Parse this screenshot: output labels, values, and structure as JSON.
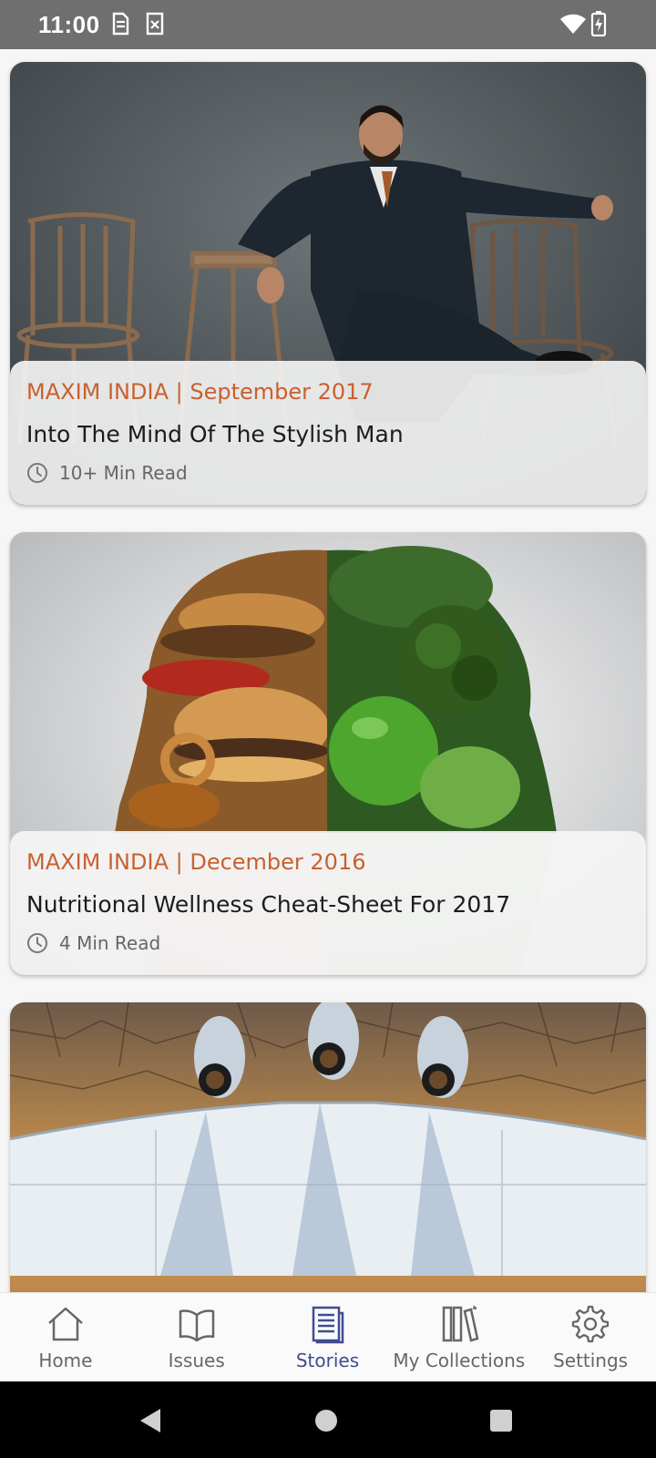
{
  "status_bar": {
    "time": "11:00",
    "icons": [
      "sim-card-icon",
      "storage-icon",
      "wifi-icon",
      "battery-charging-icon"
    ]
  },
  "feed": {
    "cards": [
      {
        "source": "MAXIM INDIA | September 2017",
        "title": "Into The Mind Of The Stylish Man",
        "read_time": "10+ Min Read",
        "image": "man-in-suit-sitting-photo"
      },
      {
        "source": "MAXIM INDIA | December 2016",
        "title": "Nutritional Wellness Cheat-Sheet For 2017",
        "read_time": "4 Min Read",
        "image": "junk-food-vs-vegetables-head-photo"
      },
      {
        "image": "aircraft-underside-over-cracked-earth-photo"
      }
    ]
  },
  "bottom_nav": {
    "items": [
      {
        "label": "Home",
        "icon": "home-icon",
        "active": false
      },
      {
        "label": "Issues",
        "icon": "book-icon",
        "active": false
      },
      {
        "label": "Stories",
        "icon": "document-icon",
        "active": true
      },
      {
        "label": "My Collections",
        "icon": "collections-icon",
        "active": false
      },
      {
        "label": "Settings",
        "icon": "gear-icon",
        "active": false
      }
    ]
  },
  "colors": {
    "accent": "#c8612f",
    "active_nav": "#3f4d8f",
    "status_bar": "#6f6f6f"
  }
}
